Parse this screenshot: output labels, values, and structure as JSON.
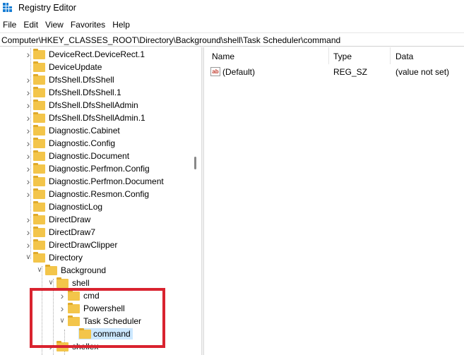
{
  "window": {
    "title": "Registry Editor"
  },
  "menu": [
    "File",
    "Edit",
    "View",
    "Favorites",
    "Help"
  ],
  "address": "Computer\\HKEY_CLASSES_ROOT\\Directory\\Background\\shell\\Task Scheduler\\command",
  "tree": [
    {
      "label": "DeviceRect.DeviceRect.1",
      "level": 1,
      "chevron": "right"
    },
    {
      "label": "DeviceUpdate",
      "level": 1,
      "chevron": "none"
    },
    {
      "label": "DfsShell.DfsShell",
      "level": 1,
      "chevron": "right"
    },
    {
      "label": "DfsShell.DfsShell.1",
      "level": 1,
      "chevron": "right"
    },
    {
      "label": "DfsShell.DfsShellAdmin",
      "level": 1,
      "chevron": "right"
    },
    {
      "label": "DfsShell.DfsShellAdmin.1",
      "level": 1,
      "chevron": "right"
    },
    {
      "label": "Diagnostic.Cabinet",
      "level": 1,
      "chevron": "right"
    },
    {
      "label": "Diagnostic.Config",
      "level": 1,
      "chevron": "right"
    },
    {
      "label": "Diagnostic.Document",
      "level": 1,
      "chevron": "right"
    },
    {
      "label": "Diagnostic.Perfmon.Config",
      "level": 1,
      "chevron": "right"
    },
    {
      "label": "Diagnostic.Perfmon.Document",
      "level": 1,
      "chevron": "right"
    },
    {
      "label": "Diagnostic.Resmon.Config",
      "level": 1,
      "chevron": "right"
    },
    {
      "label": "DiagnosticLog",
      "level": 1,
      "chevron": "none"
    },
    {
      "label": "DirectDraw",
      "level": 1,
      "chevron": "right"
    },
    {
      "label": "DirectDraw7",
      "level": 1,
      "chevron": "right"
    },
    {
      "label": "DirectDrawClipper",
      "level": 1,
      "chevron": "right"
    },
    {
      "label": "Directory",
      "level": 1,
      "chevron": "down"
    },
    {
      "label": "Background",
      "level": 2,
      "chevron": "down"
    },
    {
      "label": "shell",
      "level": 3,
      "chevron": "down"
    },
    {
      "label": "cmd",
      "level": 4,
      "chevron": "right"
    },
    {
      "label": "Powershell",
      "level": 4,
      "chevron": "right"
    },
    {
      "label": "Task Scheduler",
      "level": 4,
      "chevron": "down"
    },
    {
      "label": "command",
      "level": 5,
      "chevron": "none",
      "selected": true
    },
    {
      "label": "shellex",
      "level": 3,
      "chevron": "right"
    }
  ],
  "list": {
    "columns": [
      "Name",
      "Type",
      "Data"
    ],
    "rows": [
      {
        "name": "(Default)",
        "type": "REG_SZ",
        "data": "(value not set)",
        "icon": "ab"
      }
    ]
  },
  "colors": {
    "highlight": "#d9232f",
    "selection": "#cce8ff"
  }
}
